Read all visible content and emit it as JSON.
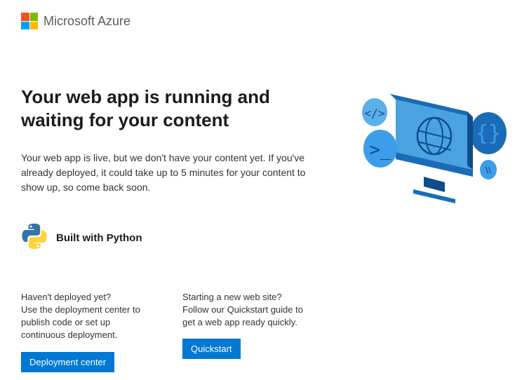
{
  "header": {
    "brand": "Microsoft Azure"
  },
  "main": {
    "title": "Your web app is running and waiting for your content",
    "description": "Your web app is live, but we don't have your content yet. If you've already deployed, it could take up to 5 minutes for your content to show up, so come back soon.",
    "built_with": "Built with Python"
  },
  "cards": {
    "deploy": {
      "question": "Haven't deployed yet?",
      "body": "Use the deployment center to publish code or set up continuous deployment.",
      "button": "Deployment center"
    },
    "quickstart": {
      "question": "Starting a new web site?",
      "body": "Follow our Quickstart guide to get a web app ready quickly.",
      "button": "Quickstart"
    }
  },
  "colors": {
    "primary": "#0078d4"
  }
}
